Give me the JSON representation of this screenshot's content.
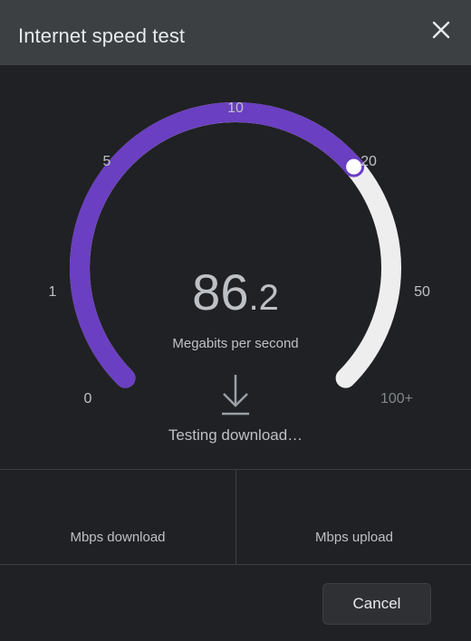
{
  "dialog": {
    "title": "Internet speed test"
  },
  "gauge": {
    "ticks": [
      "0",
      "1",
      "5",
      "10",
      "20",
      "50",
      "100+"
    ],
    "value_integer": "86",
    "value_decimal": ".2",
    "unit": "Megabits per second",
    "status": "Testing download…",
    "accent_color": "#6a3fc1",
    "track_color": "#eeeeee",
    "progress_fraction": 0.683
  },
  "results": {
    "download_label": "Mbps download",
    "upload_label": "Mbps upload"
  },
  "footer": {
    "cancel_label": "Cancel"
  },
  "icons": [
    "close-icon",
    "download-arrow-icon"
  ]
}
